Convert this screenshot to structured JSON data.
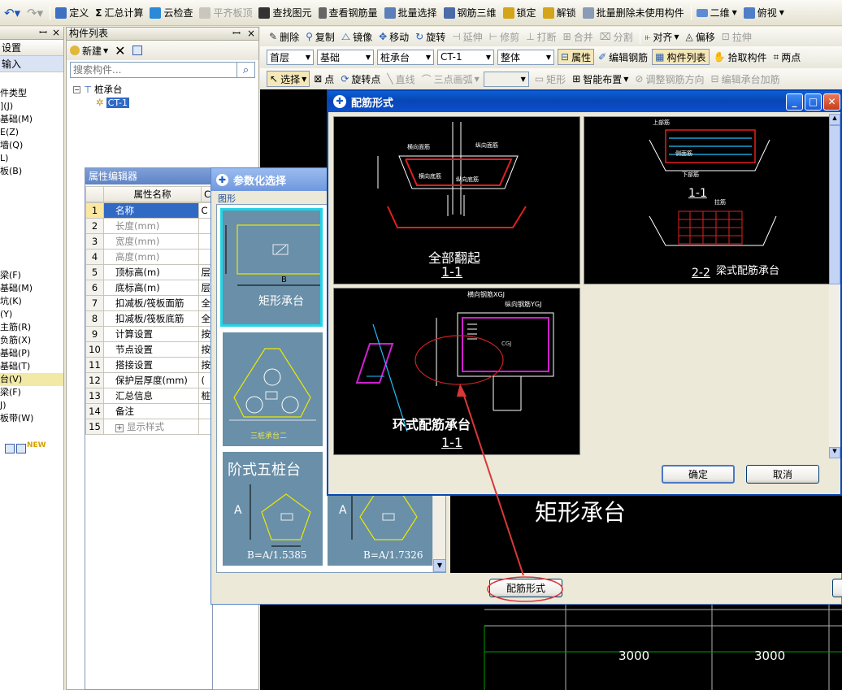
{
  "toolbar1": {
    "items": [
      "定义",
      "汇总计算",
      "云检查",
      "平齐板顶",
      "查找图元",
      "查看钢筋量",
      "批量选择",
      "钢筋三维",
      "锁定",
      "解锁",
      "批量删除未使用构件",
      "二维",
      "俯视"
    ]
  },
  "left_nav": {
    "header": "设置",
    "subheader": "输入",
    "items": [
      "件类型",
      "](J)",
      "基础(M)",
      "E(Z)",
      "墙(Q)",
      "L)",
      "板(B)",
      "梁(F)",
      "基础(M)",
      "坑(K)",
      "(Y)",
      "主筋(R)",
      "负筋(X)",
      "基础(P)",
      "基础(T)",
      "台(V)",
      "梁(F)",
      "J)",
      "板带(W)"
    ],
    "new_badge": "NEW"
  },
  "component_list": {
    "title": "构件列表",
    "pin": "ꟷ",
    "close": "×",
    "new_label": "新建",
    "search_placeholder": "搜索构件...",
    "tree_root": "桩承台",
    "tree_child": "CT-1"
  },
  "toolbar2": {
    "items": [
      "删除",
      "复制",
      "镜像",
      "移动",
      "旋转",
      "延伸",
      "修剪",
      "打断",
      "合并",
      "分割",
      "对齐",
      "偏移",
      "拉伸"
    ]
  },
  "toolbar3": {
    "floor": "首层",
    "category": "基础",
    "type": "桩承台",
    "component": "CT-1",
    "scope": "整体",
    "btn_props": "属性",
    "btn_edit_rebar": "编辑钢筋",
    "btn_comp_list": "构件列表",
    "btn_pick": "拾取构件",
    "btn_twopoint": "两点"
  },
  "toolbar4": {
    "items": [
      "选择",
      "点",
      "旋转点",
      "直线",
      "三点画弧",
      "矩形",
      "智能布置",
      "调整钢筋方向",
      "编辑承台加筋"
    ]
  },
  "property_editor": {
    "title": "属性编辑器",
    "col_name": "属性名称",
    "col_value_partial": "C",
    "rows": [
      {
        "n": "1",
        "name": "名称",
        "val": "C",
        "sel": true
      },
      {
        "n": "2",
        "name": "长度(mm)",
        "val": "",
        "gray": true
      },
      {
        "n": "3",
        "name": "宽度(mm)",
        "val": "",
        "gray": true
      },
      {
        "n": "4",
        "name": "高度(mm)",
        "val": "",
        "gray": true
      },
      {
        "n": "5",
        "name": "顶标高(m)",
        "val": "层"
      },
      {
        "n": "6",
        "name": "底标高(m)",
        "val": "层"
      },
      {
        "n": "7",
        "name": "扣减板/筏板面筋",
        "val": "全"
      },
      {
        "n": "8",
        "name": "扣减板/筏板底筋",
        "val": "全"
      },
      {
        "n": "9",
        "name": "计算设置",
        "val": "按"
      },
      {
        "n": "10",
        "name": "节点设置",
        "val": "按"
      },
      {
        "n": "11",
        "name": "搭接设置",
        "val": "按"
      },
      {
        "n": "12",
        "name": "保护层厚度(mm)",
        "val": "("
      },
      {
        "n": "13",
        "name": "汇总信息",
        "val": "桩"
      },
      {
        "n": "14",
        "name": "备注",
        "val": ""
      },
      {
        "n": "15",
        "name": "显示样式",
        "val": "",
        "gray": true,
        "expand": "+"
      }
    ]
  },
  "param_dialog": {
    "title": "参数化选择",
    "group_label": "图形",
    "thumbs": [
      {
        "label": "矩形承台",
        "dim": "B"
      },
      {
        "label": "三桩承台二"
      },
      {
        "label": "阶式五桩台",
        "dim": "A",
        "formula": "B=A/1.5385"
      },
      {
        "label": "",
        "dim": "A",
        "formula": "B=A/1.7326"
      }
    ],
    "preview_title": "矩形承台",
    "button_rebar_form": "配筋形式"
  },
  "rebar_dialog": {
    "title": "配筋形式",
    "options": [
      {
        "caption": "全部翻起",
        "section": "1-1",
        "labels": [
          "横向面筋",
          "横向底筋",
          "纵向底筋",
          "纵向面筋"
        ]
      },
      {
        "caption": "梁式配筋承台",
        "section": "1-1",
        "section2": "2-2",
        "labels": [
          "上部筋",
          "侧面筋",
          "下部筋",
          "拉筋"
        ]
      },
      {
        "caption": "环式配筋承台",
        "section": "1-1",
        "labels": [
          "横向钢筋XGJ",
          "纵向钢筋YGJ",
          "CGJ"
        ]
      }
    ],
    "ok": "确定",
    "cancel": "取消"
  },
  "canvas": {
    "dims": [
      "3000",
      "3000"
    ]
  }
}
